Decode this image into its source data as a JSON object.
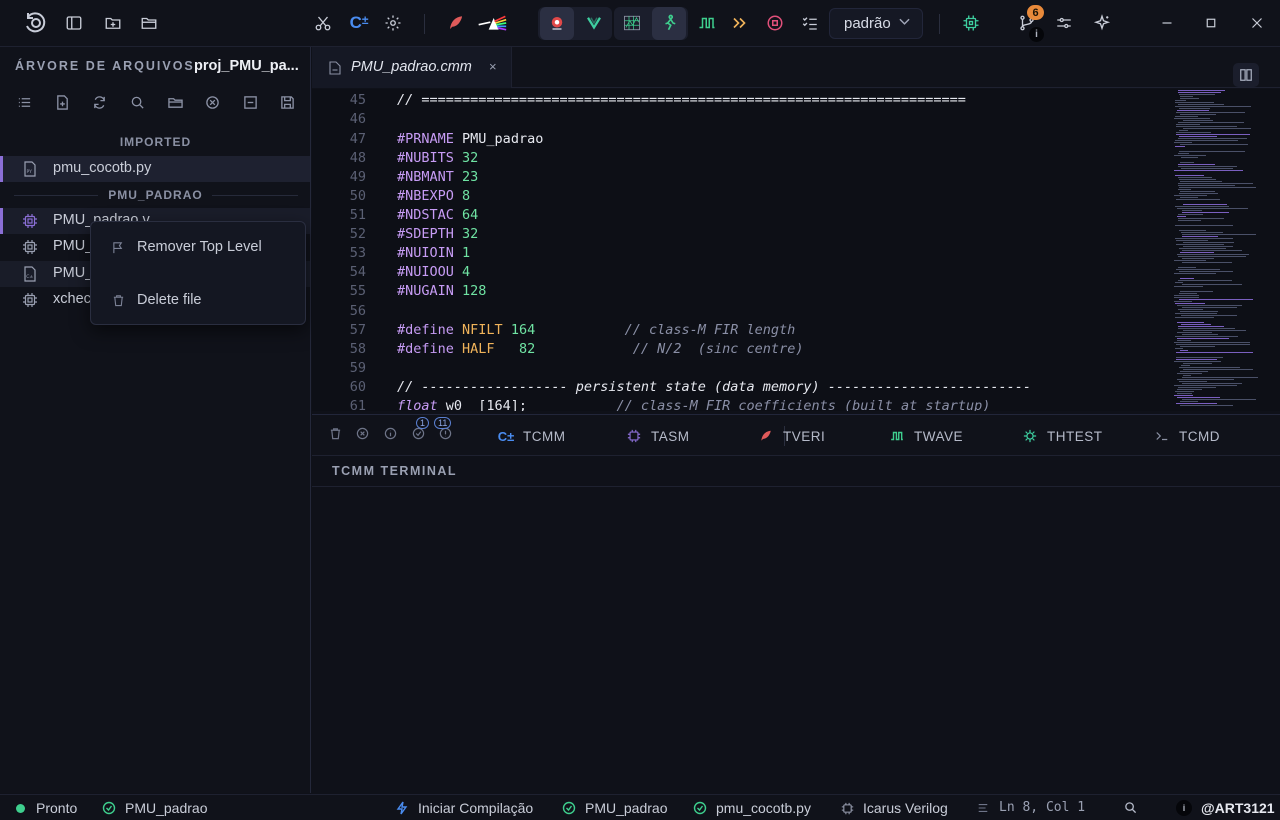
{
  "topbar": {
    "mode_value": "padrão",
    "notification_count": "6",
    "info_badge": "i",
    "colors": {
      "accent_purple": "#8b6fd6",
      "accent_green": "#3ecf8e",
      "accent_orange": "#e8893a",
      "accent_red": "#e05a5a",
      "accent_blue": "#4a8cf0"
    },
    "icons": [
      "logo-icon",
      "sidebar-toggle-icon",
      "new-folder-icon",
      "open-folder-icon",
      "cut-icon",
      "cmm-icon",
      "settings-gear-icon",
      "feather-icon",
      "prism-icon",
      "red-bug-icon",
      "v-icon",
      "waveform-grid-icon",
      "green-figure-icon",
      "pulse-icon",
      "fast-forward-icon",
      "stop-circle-icon",
      "checklist-icon",
      "chip-icon",
      "git-branch-icon",
      "sliders-icon",
      "sparkle-icon",
      "minimize-icon",
      "maximize-icon",
      "close-icon"
    ]
  },
  "sidebar": {
    "title": "ÁRVORE DE ARQUIVOS",
    "project": "proj_PMU_pa...",
    "sections": [
      {
        "label": "IMPORTED"
      },
      {
        "label": "PMU_PADRAO"
      }
    ],
    "files": [
      {
        "name": "pmu_cocotb.py"
      },
      {
        "name": "PMU_padrao.v"
      },
      {
        "name": "PMU_"
      },
      {
        "name": "PMU_"
      },
      {
        "name": "xchec"
      }
    ]
  },
  "context_menu": {
    "items": [
      {
        "label": "Remover Top Level"
      },
      {
        "label": "Delete file"
      }
    ]
  },
  "editor": {
    "tab_label": "PMU_padrao.cmm",
    "tab_close": "×",
    "lines": [
      {
        "num": "45",
        "text": "// ==================================================================="
      },
      {
        "num": "46",
        "text": ""
      },
      {
        "num": "47",
        "dir": "#PRNAME",
        "val": "PMU_padrao"
      },
      {
        "num": "48",
        "dir": "#NUBITS",
        "num_val": "32"
      },
      {
        "num": "49",
        "dir": "#NBMANT",
        "num_val": "23"
      },
      {
        "num": "50",
        "dir": "#NBEXPO",
        "num_val": "8"
      },
      {
        "num": "51",
        "dir": "#NDSTAC",
        "num_val": "64"
      },
      {
        "num": "52",
        "dir": "#SDEPTH",
        "num_val": "32"
      },
      {
        "num": "53",
        "dir": "#NUIOIN",
        "num_val": "1"
      },
      {
        "num": "54",
        "dir": "#NUIOOU",
        "num_val": "4"
      },
      {
        "num": "55",
        "dir": "#NUGAIN",
        "num_val": "128"
      },
      {
        "num": "56",
        "text": ""
      },
      {
        "num": "57",
        "define": "#define",
        "macro": "NFILT",
        "num_val": "164",
        "comment": "// class-M FIR length"
      },
      {
        "num": "58",
        "define": "#define",
        "macro": "HALF",
        "num_val": "82",
        "comment": "// N/2  (sinc centre)"
      },
      {
        "num": "59",
        "text": ""
      },
      {
        "num": "60",
        "text": "// ------------------ persistent state (data memory) -------------------------"
      },
      {
        "num": "61",
        "type": "float",
        "rest": "w0  [164];",
        "comment": "// class-M FIR coefficients (built at startup)"
      }
    ]
  },
  "panel": {
    "badges": [
      "1",
      "11"
    ],
    "tabs": [
      {
        "label": "TCMM"
      },
      {
        "label": "TASM"
      },
      {
        "label": "TVERI"
      },
      {
        "label": "TWAVE"
      },
      {
        "label": "THTEST"
      },
      {
        "label": "TCMD"
      }
    ],
    "terminal_title": "TCMM TERMINAL"
  },
  "statusbar": {
    "ready": "Pronto",
    "project": "PMU_padrao",
    "compile": "Iniciar Compilação",
    "check_project": "PMU_padrao",
    "check_file": "pmu_cocotb.py",
    "simulator": "Icarus Verilog",
    "cursor": "Ln 8, Col 1",
    "user": "@ART3121"
  }
}
